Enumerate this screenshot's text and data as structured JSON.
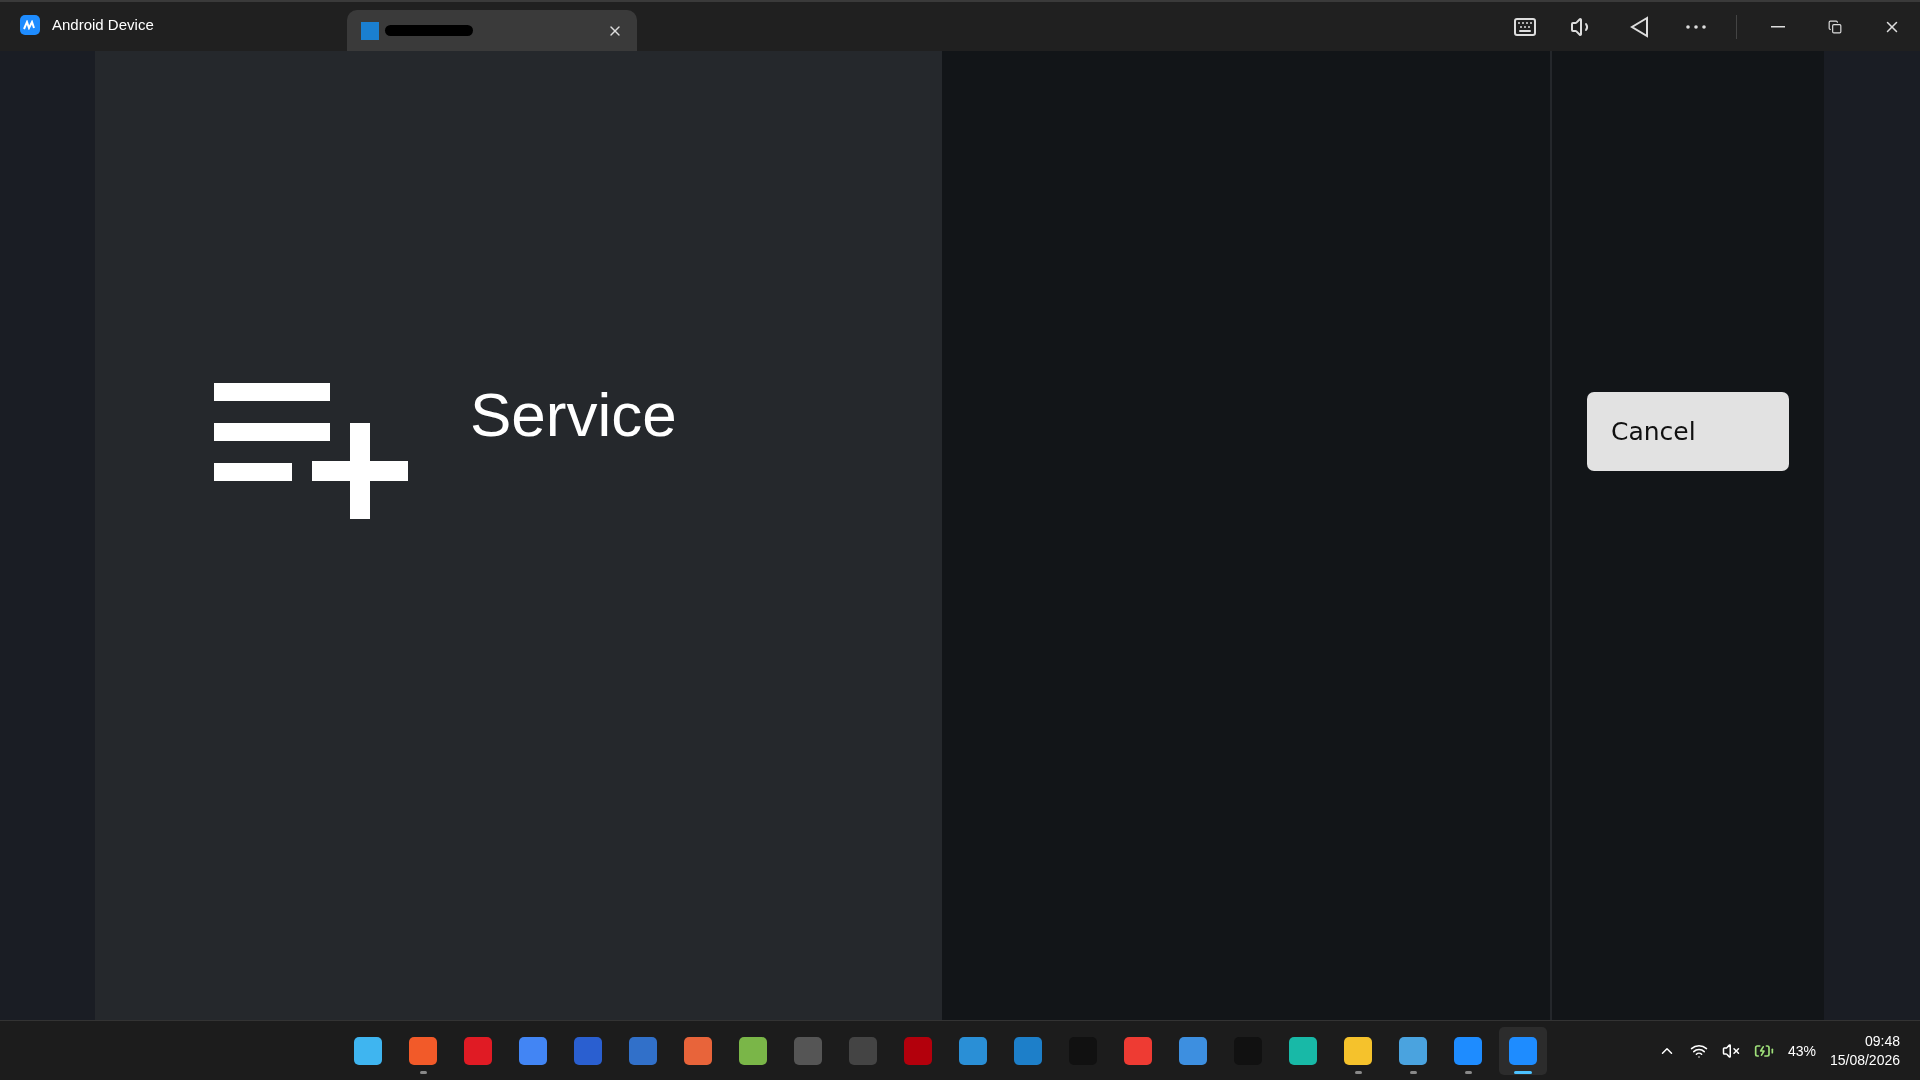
{
  "window": {
    "title": "Android Device",
    "tabs": [
      {
        "kind": "redacted",
        "selected": true
      }
    ]
  },
  "screen": {
    "menu_item": {
      "label": "Service"
    },
    "cancel_button": {
      "label": "Cancel"
    }
  },
  "taskbar": {
    "apps": [
      {
        "running": false,
        "selected": false
      },
      {
        "running": true,
        "selected": false
      },
      {
        "running": false,
        "selected": false
      },
      {
        "running": false,
        "selected": false
      },
      {
        "running": false,
        "selected": false
      },
      {
        "running": false,
        "selected": false
      },
      {
        "running": false,
        "selected": false
      },
      {
        "running": false,
        "selected": false
      },
      {
        "running": false,
        "selected": false
      },
      {
        "running": false,
        "selected": false
      },
      {
        "running": false,
        "selected": false
      },
      {
        "running": false,
        "selected": false
      },
      {
        "running": false,
        "selected": false
      },
      {
        "running": false,
        "selected": false
      },
      {
        "running": false,
        "selected": false
      },
      {
        "running": false,
        "selected": false
      },
      {
        "running": false,
        "selected": false
      },
      {
        "running": false,
        "selected": false
      },
      {
        "running": true,
        "selected": false
      },
      {
        "running": true,
        "selected": false
      },
      {
        "running": true,
        "selected": false
      },
      {
        "running": true,
        "selected": true
      }
    ],
    "battery": "43%",
    "time": "09:48",
    "date": "15/08/2026"
  }
}
